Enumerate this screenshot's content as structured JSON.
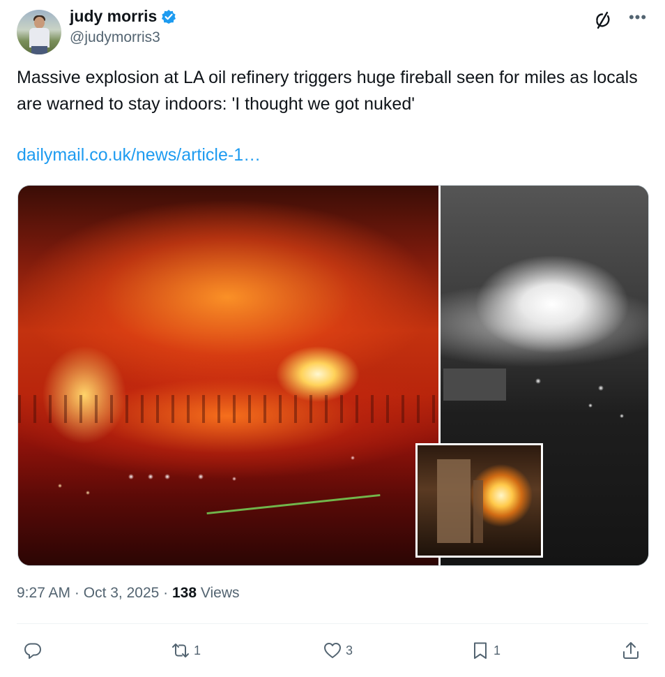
{
  "author": {
    "display_name": "judy morris",
    "handle": "@judymorris3",
    "verified": true,
    "verified_color": "#1d9bf0"
  },
  "tweet": {
    "text": "Massive explosion at LA oil refinery triggers huge fireball seen for miles as locals are warned to stay indoors: 'I thought we got nuked'",
    "link_text": "dailymail.co.uk/news/article-1…",
    "link_color": "#1d9bf0"
  },
  "meta": {
    "time": "9:27 AM",
    "sep1": " · ",
    "date": "Oct 3, 2025",
    "sep2": " · ",
    "views_count": "138",
    "views_label": " Views"
  },
  "actions": {
    "reply_count": "",
    "repost_count": "1",
    "like_count": "3",
    "bookmark_count": "1"
  },
  "icons": {
    "more": "more-icon",
    "grok": "grok-icon",
    "reply": "reply-icon",
    "repost": "repost-icon",
    "like": "heart-icon",
    "bookmark": "bookmark-icon",
    "share": "share-icon"
  }
}
